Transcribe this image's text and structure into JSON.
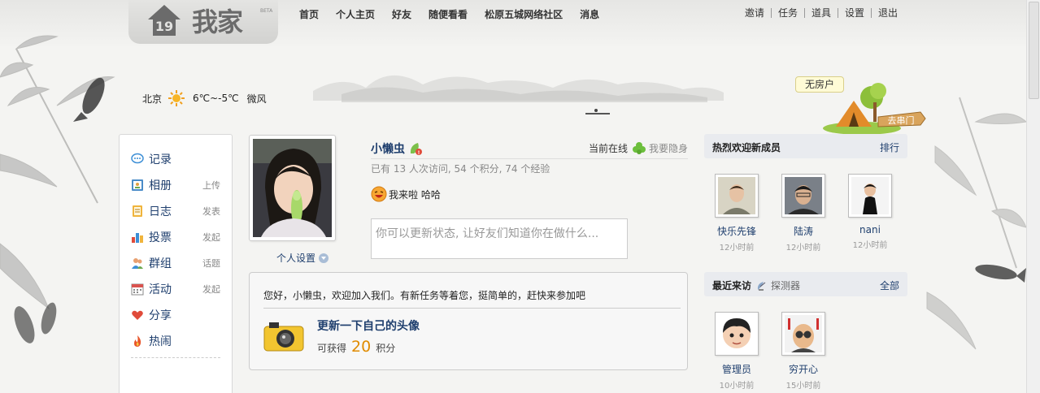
{
  "header": {
    "logo_text": "我家",
    "logo_mark": "19",
    "beta": "BETA",
    "nav": [
      "首页",
      "个人主页",
      "好友",
      "随便看看",
      "松原五城网络社区",
      "消息"
    ],
    "links": [
      "邀请",
      "任务",
      "道具",
      "设置",
      "退出"
    ]
  },
  "weather": {
    "city": "北京",
    "icon": "sun-icon",
    "temp": "6℃~-5℃",
    "wind": "微风"
  },
  "house": {
    "label": "无房户",
    "go_home": "去串门"
  },
  "sidebar": {
    "items": [
      {
        "label": "记录",
        "action": "",
        "icon": "record-icon"
      },
      {
        "label": "相册",
        "action": "上传",
        "icon": "album-icon"
      },
      {
        "label": "日志",
        "action": "发表",
        "icon": "blog-icon"
      },
      {
        "label": "投票",
        "action": "发起",
        "icon": "poll-icon"
      },
      {
        "label": "群组",
        "action": "话题",
        "icon": "group-icon"
      },
      {
        "label": "活动",
        "action": "发起",
        "icon": "event-icon"
      },
      {
        "label": "分享",
        "action": "",
        "icon": "share-icon"
      },
      {
        "label": "热闹",
        "action": "",
        "icon": "hot-icon"
      }
    ]
  },
  "profile": {
    "name": "小懒虫",
    "online": "当前在线",
    "hide": "我要隐身",
    "stats": "已有 13 人次访问, 54 个积分, 74 个经验",
    "status": "我来啦 哈哈",
    "settings": "个人设置",
    "status_placeholder": "你可以更新状态, 让好友们知道你在做什么..."
  },
  "task": {
    "welcome": "您好，小懒虫，欢迎加入我们。有新任务等着您，挺简单的，赶快来参加吧",
    "title": "更新一下自己的头像",
    "reward_prefix": "可获得",
    "reward_points": "20",
    "reward_suffix": "积分"
  },
  "new_members": {
    "title": "热烈欢迎新成员",
    "link": "排行",
    "members": [
      {
        "name": "快乐先锋",
        "time": "12小时前"
      },
      {
        "name": "陆涛",
        "time": "12小时前"
      },
      {
        "name": "nani",
        "time": "12小时前"
      }
    ]
  },
  "recent_visitors": {
    "title": "最近来访",
    "sub": "探测器",
    "link": "全部",
    "members": [
      {
        "name": "管理员",
        "time": "10小时前"
      },
      {
        "name": "穷开心",
        "time": "15小时前"
      }
    ]
  }
}
